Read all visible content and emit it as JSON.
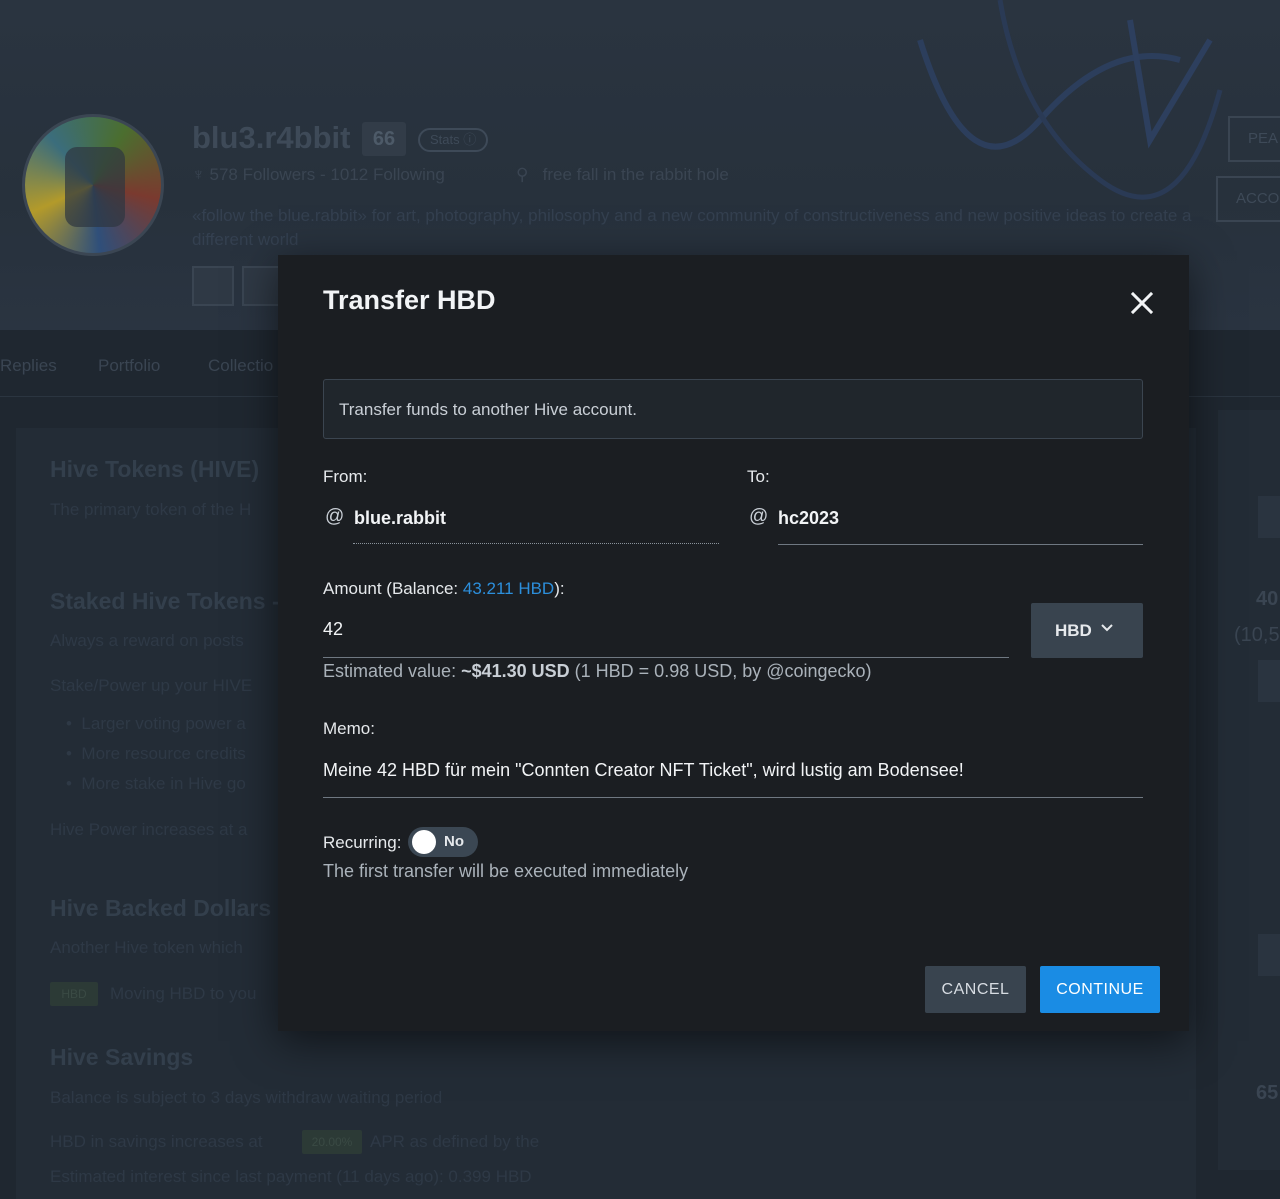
{
  "profile": {
    "name": "blu3.r4bbit",
    "reputation": "66",
    "stats_label": "Stats",
    "followers": "578 Followers",
    "following": "1012 Following",
    "location": "free fall in the rabbit hole",
    "about": "«follow the blue.rabbit» for art, photography, philosophy and a new community of constructiveness and new positive ideas to create a different world",
    "button_peak": "PEA",
    "button_account": "ACCO"
  },
  "nav": {
    "replies": "Replies",
    "portfolio": "Portfolio",
    "collections": "Collectio"
  },
  "wallet_bg": {
    "hive_title": "Hive Tokens (HIVE)",
    "hive_desc": "The primary token of the H",
    "staked_title": "Staked Hive Tokens -",
    "staked_desc": "Always a reward on posts",
    "stake_up": "Stake/Power up your HIVE",
    "bullet1": "Larger voting power a",
    "bullet2": "More resource credits",
    "bullet3": "More stake in Hive go",
    "hp_increase": "Hive Power increases at a",
    "hbd_title": "Hive Backed Dollars (",
    "hbd_desc": "Another Hive token which",
    "hbd_pill": "HBD",
    "hbd_moving": "Moving HBD to you",
    "savings_title": "Hive Savings",
    "savings_desc": "Balance is subject to 3 days withdraw waiting period",
    "savings_apr_pre": "HBD in savings increases at",
    "savings_apr_pill": "20.00%",
    "savings_apr_post": "APR as defined by the",
    "interest": "Estimated interest since last payment (11 days ago): 0.399 HBD",
    "right_num1": "40",
    "right_num2": "(10,5",
    "right_num3": "65"
  },
  "dialog": {
    "title": "Transfer HBD",
    "info": "Transfer funds to another Hive account.",
    "from_label": "From:",
    "to_label": "To:",
    "at_symbol": "@",
    "from_account": "blue.rabbit",
    "to_account": "hc2023",
    "amount_label_pre": "Amount (Balance: ",
    "balance": "43.211 HBD",
    "amount_label_post": "):",
    "amount_value": "42",
    "currency": "HBD",
    "est_pre": "Estimated value: ",
    "est_value": "~$41.30 USD",
    "est_post": " (1 HBD = 0.98 USD, by @coingecko)",
    "memo_label": "Memo:",
    "memo_value": "Meine 42 HBD für mein \"Connten Creator NFT Ticket\", wird lustig am Bodensee!",
    "recurring_label": "Recurring:",
    "recurring_state": "No",
    "first_transfer_note": "The first transfer will be executed immediately",
    "cancel_label": "CANCEL",
    "continue_label": "CONTINUE"
  },
  "colors": {
    "accent": "#1a8ce4",
    "dialog_bg": "#1b1e22",
    "page_bg": "#1f2730"
  }
}
